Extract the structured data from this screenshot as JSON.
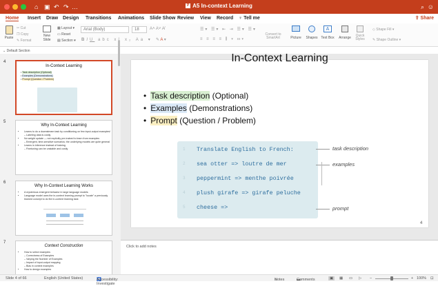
{
  "window": {
    "title": "A5 In-context Learning",
    "colors": {
      "accent": "#c43e1c",
      "traffic_red": "#ff5f57",
      "traffic_yellow": "#febc2e",
      "traffic_green": "#28c840"
    }
  },
  "menu": {
    "tabs": [
      "Home",
      "Insert",
      "Draw",
      "Design",
      "Transitions",
      "Animations",
      "Slide Show",
      "Review",
      "View",
      "Record",
      "Tell me"
    ],
    "share": "Share"
  },
  "ribbon": {
    "paste": "Paste",
    "cut": "Cut",
    "copy": "Copy",
    "format": "Format",
    "new_slide": "New Slide",
    "layout": "Layout",
    "reset": "Reset",
    "section": "Section",
    "font_name": "Arial (Body)",
    "font_size": "18",
    "convert_smartart": "Convert to SmartArt",
    "picture": "Picture",
    "shapes": "Shapes",
    "text_box": "Text Box",
    "arrange": "Arrange",
    "quick_styles": "Quick Styles",
    "shape_fill": "Shape Fill",
    "shape_outline": "Shape Outline"
  },
  "sidebar": {
    "section_label": "Default Section",
    "slides": [
      {
        "number": "4",
        "title": "In-Context Learning",
        "bullets": [
          "Task description (Optional)",
          "Examples (Demonstrations)",
          "Prompt (Question / Problem)"
        ]
      },
      {
        "number": "5",
        "title": "Why In-Context Learning",
        "bullets": [
          "Learns to do a downstream task by conditioning on few input-output examples!",
          "– Labeling data is costly",
          "No weight update — not explicitly pre-trained to learn from examples",
          "– Emergent, time-sensitive scenarios; the underlying models are quite general",
          "Learns in inference instead of training",
          "– Finetuning can be unstable and costly"
        ]
      },
      {
        "number": "6",
        "title": "Why In-Context Learning Works",
        "bullets": [
          "A mysterious emergent behavior in large language models",
          "Language model uses the in-context learning prompt to \"locate\" a previously learned concept to do the in-context learning task"
        ]
      },
      {
        "number": "7",
        "title": "Context Construction",
        "bullets": [
          "How to select examples",
          "– Correctness of Examples",
          "– Varying the Number of Examples",
          "– Impact of input-output mapping",
          "– Bias in context examples",
          "How to design examples"
        ]
      }
    ]
  },
  "slide": {
    "title": "In-Context Learning",
    "bullets": [
      {
        "highlight": "Task description",
        "rest": " (Optional)"
      },
      {
        "highlight": "Examples",
        "rest": " (Demonstrations)"
      },
      {
        "highlight": "Prompt",
        "rest": " (Question / Problem)"
      }
    ],
    "code_lines": [
      {
        "n": "1",
        "text": "Translate English to French:"
      },
      {
        "n": "2",
        "text": "sea otter => loutre de mer"
      },
      {
        "n": "3",
        "text": "peppermint => menthe poivrée"
      },
      {
        "n": "4",
        "text": "plush girafe => girafe peluche"
      },
      {
        "n": "5",
        "text": "cheese =>"
      }
    ],
    "annotations": {
      "task": "task description",
      "examples": "examples",
      "prompt": "prompt"
    },
    "page_number": "4"
  },
  "notes": {
    "placeholder": "Click to add notes"
  },
  "status": {
    "slide_info": "Slide 4 of 66",
    "language": "English (United States)",
    "accessibility": "Accessibility: Investigate",
    "notes": "Notes",
    "comments": "Comments",
    "zoom": "100%"
  }
}
